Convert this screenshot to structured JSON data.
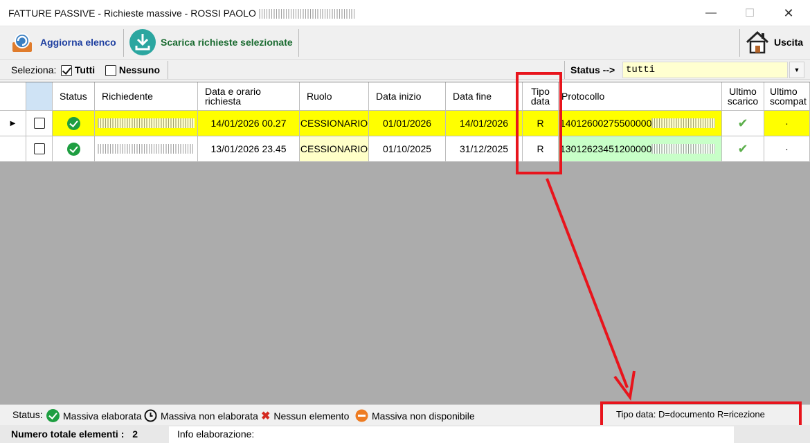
{
  "window": {
    "title": "FATTURE PASSIVE - Richieste massive - ROSSI PAOLO",
    "minimize_glyph": "—",
    "maximize_glyph": "☐",
    "close_glyph": "✕"
  },
  "toolbar": {
    "refresh_label": "Aggiorna elenco",
    "download_label": "Scarica richieste selezionate",
    "exit_label": "Uscita"
  },
  "selection": {
    "label": "Seleziona:",
    "all_label": "Tutti",
    "none_label": "Nessuno",
    "status_label": "Status -->",
    "status_value": "tutti"
  },
  "table": {
    "headers": {
      "status": "Status",
      "richiedente": "Richiedente",
      "data_orario": "Data e orario richiesta",
      "ruolo": "Ruolo",
      "data_inizio": "Data inizio",
      "data_fine": "Data fine",
      "tipo_data": "Tipo data",
      "protocollo": "Protocollo",
      "ultimo_scarico": "Ultimo scarico",
      "ultimo_scompat": "Ultimo scompat"
    },
    "rows": [
      {
        "data_orario": "14/01/2026 00.27",
        "ruolo": "CESSIONARIO",
        "data_inizio": "01/01/2026",
        "data_fine": "14/01/2026",
        "tipo_data": "R",
        "protocollo": "14012600275500000",
        "ultimo_scompat": "·"
      },
      {
        "data_orario": "13/01/2026 23.45",
        "ruolo": "CESSIONARIO",
        "data_inizio": "01/10/2025",
        "data_fine": "31/12/2025",
        "tipo_data": "R",
        "protocollo": "13012623451200000",
        "ultimo_scompat": "·"
      }
    ]
  },
  "legend": {
    "label": "Status:",
    "elaborata": "Massiva elaborata",
    "non_elaborata": "Massiva non elaborata",
    "nessun_elemento": "Nessun elemento",
    "non_disponibile": "Massiva non disponibile",
    "tipo_data": "Tipo data:  D=documento   R=ricezione"
  },
  "footer": {
    "total_label": "Numero totale elementi :",
    "total_value": "2",
    "info_label": "Info elaborazione:"
  },
  "colors": {
    "selected_row": "#ffff00",
    "ruolo_cell": "#ffffc8",
    "protocollo_cell": "#c8ffc8",
    "annotation_red": "#e8141c"
  }
}
